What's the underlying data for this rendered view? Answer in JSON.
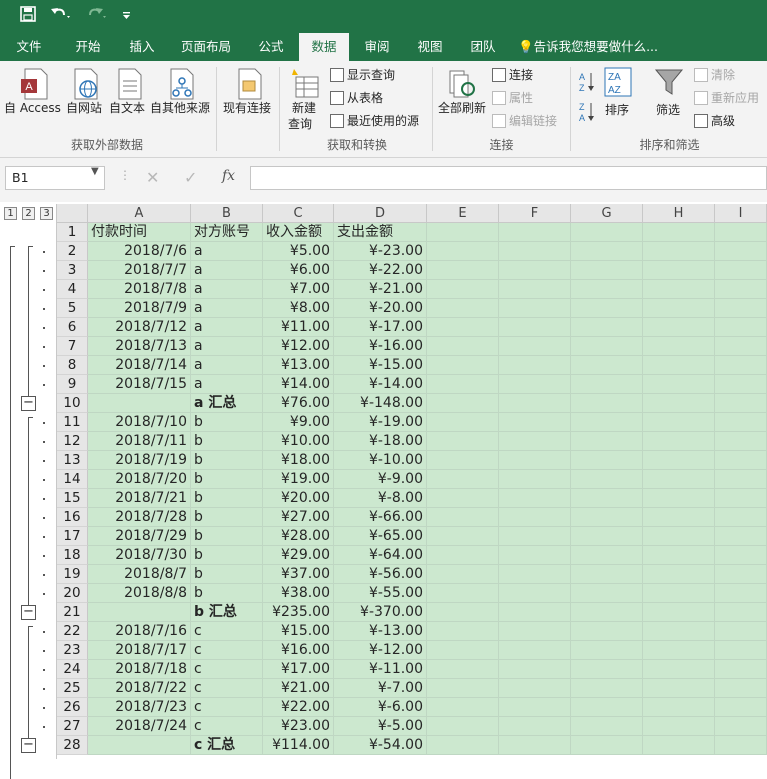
{
  "qat": {
    "save_icon": "save-icon",
    "undo_icon": "undo-icon",
    "redo_icon": "redo-icon",
    "customize_icon": "chevron-down-icon"
  },
  "tabs": [
    "文件",
    "开始",
    "插入",
    "页面布局",
    "公式",
    "数据",
    "审阅",
    "视图",
    "团队"
  ],
  "active_tab": "数据",
  "tell_me": "告诉我您想要做什么...",
  "ribbon": {
    "get_external": {
      "items": [
        "自 Access",
        "自网站",
        "自文本",
        "自其他来源"
      ],
      "label": "获取外部数据"
    },
    "existing": "现有连接",
    "new_query": [
      "新建",
      "查询"
    ],
    "get_transform_small": [
      "显示查询",
      "从表格",
      "最近使用的源"
    ],
    "get_transform_label": "获取和转换",
    "refresh_all": "全部刷新",
    "connections_small": [
      "连接",
      "属性",
      "编辑链接"
    ],
    "connections_label": "连接",
    "sort_az_icon": "sort-ascending-icon",
    "sort_za_icon": "sort-descending-icon",
    "sort": "排序",
    "filter": "筛选",
    "filter_small": [
      "清除",
      "重新应用",
      "高级"
    ],
    "sort_filter_label": "排序和筛选"
  },
  "formula_bar": {
    "name_box": "B1",
    "fx": "fx",
    "cancel": "✕",
    "enter": "✓",
    "value": ""
  },
  "outline_levels": [
    "1",
    "2",
    "3"
  ],
  "columns": [
    "A",
    "B",
    "C",
    "D",
    "E",
    "F",
    "G",
    "H",
    "I"
  ],
  "rows": [
    {
      "n": "1",
      "a": "付款时间",
      "b": "对方账号",
      "c": "收入金额",
      "d": "支出金额",
      "hdr": true
    },
    {
      "n": "2",
      "a": "2018/7/6",
      "b": "a",
      "c": "¥5.00",
      "d": "¥-23.00"
    },
    {
      "n": "3",
      "a": "2018/7/7",
      "b": "a",
      "c": "¥6.00",
      "d": "¥-22.00"
    },
    {
      "n": "4",
      "a": "2018/7/8",
      "b": "a",
      "c": "¥7.00",
      "d": "¥-21.00"
    },
    {
      "n": "5",
      "a": "2018/7/9",
      "b": "a",
      "c": "¥8.00",
      "d": "¥-20.00"
    },
    {
      "n": "6",
      "a": "2018/7/12",
      "b": "a",
      "c": "¥11.00",
      "d": "¥-17.00"
    },
    {
      "n": "7",
      "a": "2018/7/13",
      "b": "a",
      "c": "¥12.00",
      "d": "¥-16.00"
    },
    {
      "n": "8",
      "a": "2018/7/14",
      "b": "a",
      "c": "¥13.00",
      "d": "¥-15.00"
    },
    {
      "n": "9",
      "a": "2018/7/15",
      "b": "a",
      "c": "¥14.00",
      "d": "¥-14.00"
    },
    {
      "n": "10",
      "a": "",
      "b": "a 汇总",
      "c": "¥76.00",
      "d": "¥-148.00",
      "total": true
    },
    {
      "n": "11",
      "a": "2018/7/10",
      "b": "b",
      "c": "¥9.00",
      "d": "¥-19.00"
    },
    {
      "n": "12",
      "a": "2018/7/11",
      "b": "b",
      "c": "¥10.00",
      "d": "¥-18.00"
    },
    {
      "n": "13",
      "a": "2018/7/19",
      "b": "b",
      "c": "¥18.00",
      "d": "¥-10.00"
    },
    {
      "n": "14",
      "a": "2018/7/20",
      "b": "b",
      "c": "¥19.00",
      "d": "¥-9.00"
    },
    {
      "n": "15",
      "a": "2018/7/21",
      "b": "b",
      "c": "¥20.00",
      "d": "¥-8.00"
    },
    {
      "n": "16",
      "a": "2018/7/28",
      "b": "b",
      "c": "¥27.00",
      "d": "¥-66.00"
    },
    {
      "n": "17",
      "a": "2018/7/29",
      "b": "b",
      "c": "¥28.00",
      "d": "¥-65.00"
    },
    {
      "n": "18",
      "a": "2018/7/30",
      "b": "b",
      "c": "¥29.00",
      "d": "¥-64.00"
    },
    {
      "n": "19",
      "a": "2018/8/7",
      "b": "b",
      "c": "¥37.00",
      "d": "¥-56.00"
    },
    {
      "n": "20",
      "a": "2018/8/8",
      "b": "b",
      "c": "¥38.00",
      "d": "¥-55.00"
    },
    {
      "n": "21",
      "a": "",
      "b": "b 汇总",
      "c": "¥235.00",
      "d": "¥-370.00",
      "total": true
    },
    {
      "n": "22",
      "a": "2018/7/16",
      "b": "c",
      "c": "¥15.00",
      "d": "¥-13.00"
    },
    {
      "n": "23",
      "a": "2018/7/17",
      "b": "c",
      "c": "¥16.00",
      "d": "¥-12.00"
    },
    {
      "n": "24",
      "a": "2018/7/18",
      "b": "c",
      "c": "¥17.00",
      "d": "¥-11.00"
    },
    {
      "n": "25",
      "a": "2018/7/22",
      "b": "c",
      "c": "¥21.00",
      "d": "¥-7.00"
    },
    {
      "n": "26",
      "a": "2018/7/23",
      "b": "c",
      "c": "¥22.00",
      "d": "¥-6.00"
    },
    {
      "n": "27",
      "a": "2018/7/24",
      "b": "c",
      "c": "¥23.00",
      "d": "¥-5.00"
    },
    {
      "n": "28",
      "a": "",
      "b": "c 汇总",
      "c": "¥114.00",
      "d": "¥-54.00",
      "total": true
    }
  ],
  "colors": {
    "brand": "#217346",
    "cell_fill": "#cce8cf"
  }
}
